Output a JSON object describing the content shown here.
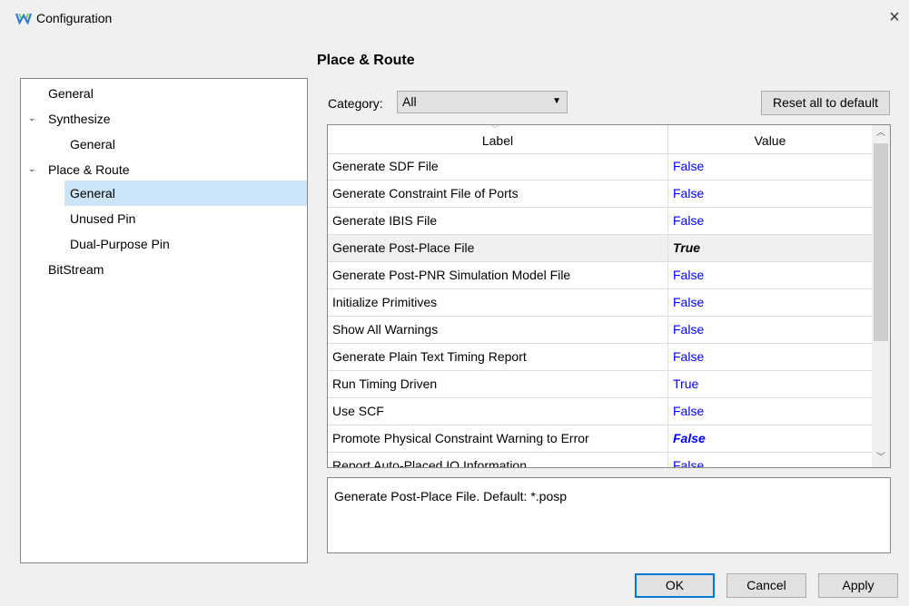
{
  "window": {
    "title": "Configuration",
    "icon": "gowin-logo-icon",
    "close": "×"
  },
  "page": {
    "title": "Place & Route"
  },
  "tree": {
    "items": [
      {
        "label": "General",
        "level": 0,
        "expanded": null,
        "selected": false
      },
      {
        "label": "Synthesize",
        "level": 0,
        "expanded": true,
        "selected": false
      },
      {
        "label": "General",
        "level": 1,
        "expanded": null,
        "selected": false
      },
      {
        "label": "Place & Route",
        "level": 0,
        "expanded": true,
        "selected": false
      },
      {
        "label": "General",
        "level": 1,
        "expanded": null,
        "selected": true
      },
      {
        "label": "Unused Pin",
        "level": 1,
        "expanded": null,
        "selected": false
      },
      {
        "label": "Dual-Purpose Pin",
        "level": 1,
        "expanded": null,
        "selected": false
      },
      {
        "label": "BitStream",
        "level": 0,
        "expanded": null,
        "selected": false
      }
    ],
    "expand_glyph": "⌄"
  },
  "category": {
    "label": "Category:",
    "value": "All"
  },
  "reset_button": "Reset all to default",
  "grid": {
    "headers": {
      "label": "Label",
      "value": "Value"
    },
    "rows": [
      {
        "label": "Generate SDF File",
        "value": "False",
        "style": "normal"
      },
      {
        "label": "Generate Constraint File of Ports",
        "value": "False",
        "style": "normal"
      },
      {
        "label": "Generate IBIS File",
        "value": "False",
        "style": "normal"
      },
      {
        "label": "Generate Post-Place File",
        "value": "True",
        "style": "bold-dark",
        "highlighted": true
      },
      {
        "label": "Generate Post-PNR Simulation Model File",
        "value": "False",
        "style": "normal"
      },
      {
        "label": "Initialize Primitives",
        "value": "False",
        "style": "normal"
      },
      {
        "label": "Show All Warnings",
        "value": "False",
        "style": "normal"
      },
      {
        "label": "Generate Plain Text Timing Report",
        "value": "False",
        "style": "normal"
      },
      {
        "label": "Run Timing Driven",
        "value": "True",
        "style": "normal"
      },
      {
        "label": "Use SCF",
        "value": "False",
        "style": "normal"
      },
      {
        "label": "Promote Physical Constraint Warning to Error",
        "value": "False",
        "style": "bold-blue"
      },
      {
        "label": "Report Auto-Placed IO Information",
        "value": "False",
        "style": "normal"
      }
    ]
  },
  "description": "Generate Post-Place File. Default: *.posp",
  "buttons": {
    "ok": "OK",
    "cancel": "Cancel",
    "apply": "Apply"
  },
  "colors": {
    "selection": "#cce4f7",
    "value_blue": "#0000ff",
    "focus_border": "#0078d7"
  }
}
